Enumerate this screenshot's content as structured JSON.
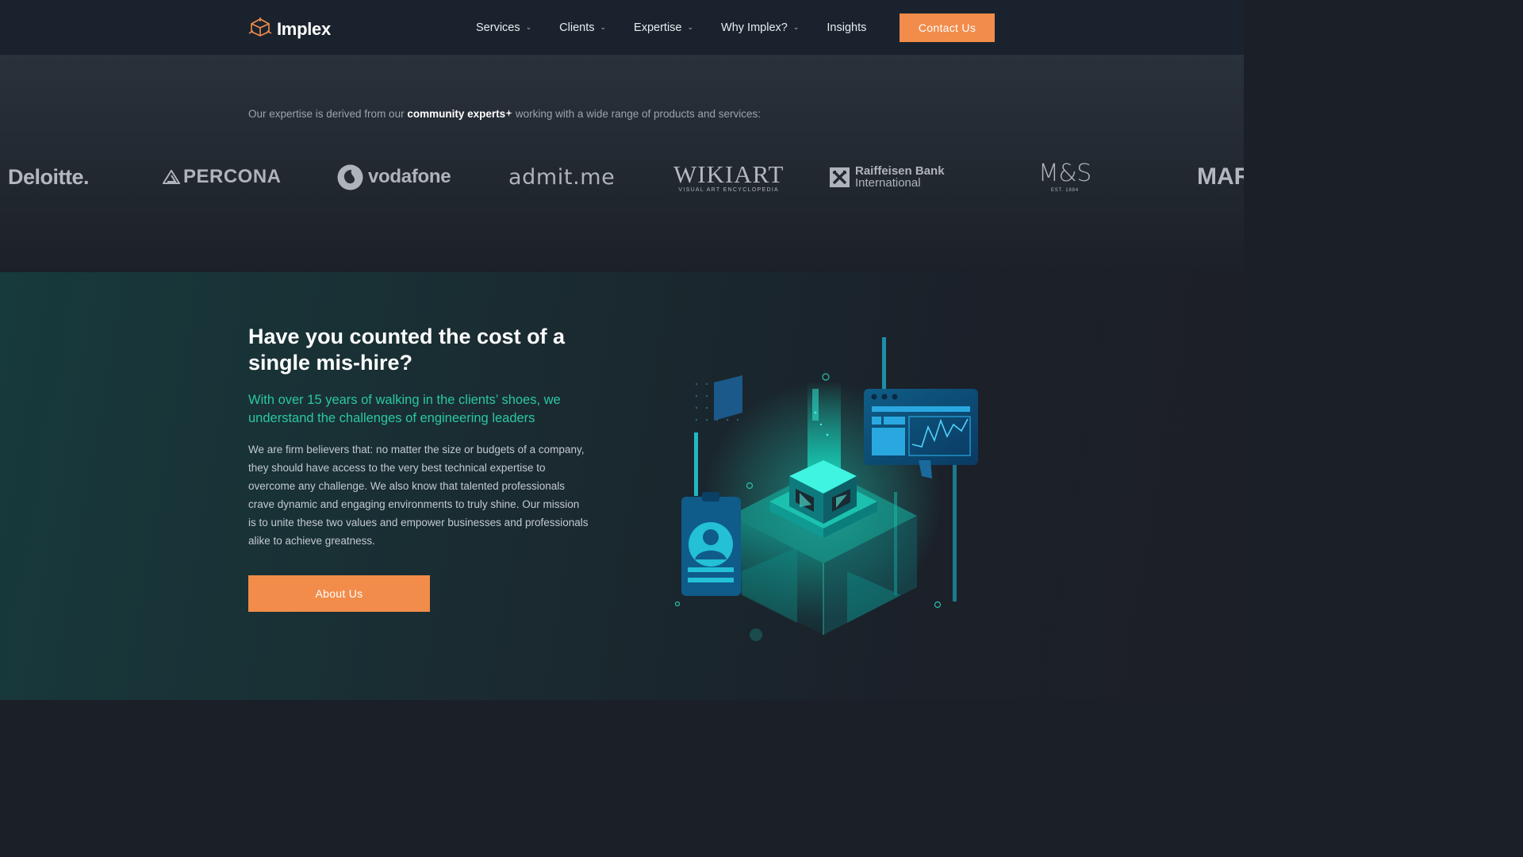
{
  "header": {
    "brand": "Implex",
    "nav": [
      {
        "label": "Services",
        "has_dropdown": true
      },
      {
        "label": "Clients",
        "has_dropdown": true
      },
      {
        "label": "Expertise",
        "has_dropdown": true
      },
      {
        "label": "Why Implex?",
        "has_dropdown": true
      },
      {
        "label": "Insights",
        "has_dropdown": false
      }
    ],
    "contact_label": "Contact Us"
  },
  "clients": {
    "intro_before": "Our expertise is derived from our ",
    "intro_highlight": "community experts",
    "intro_after": " working with a wide range of products and services:",
    "logos": [
      {
        "name": "Deloitte."
      },
      {
        "name": "PERCONA"
      },
      {
        "name": "vodafone"
      },
      {
        "name": "admit.me"
      },
      {
        "name": "WikiArt",
        "tagline": "VISUAL ART ENCYCLOPEDIA"
      },
      {
        "name": "Raiffeisen Bank",
        "tagline": "International"
      },
      {
        "name": "M&S",
        "tagline": "EST. 1884"
      },
      {
        "name": "MAR"
      }
    ]
  },
  "mishire": {
    "title": "Have you counted the cost of a single mis-hire?",
    "subtitle": "With over 15 years of walking in the clients’ shoes, we understand the challenges of engineering leaders",
    "body": "We are firm believers that: no matter the size or budgets of a company, they should have access to the very best technical expertise to overcome any challenge. We also know that talented professionals crave dynamic and engaging environments to truly shine. Our mission is to unite these two values and empower businesses and professionals alike to achieve greatness.",
    "button_label": "About Us"
  },
  "colors": {
    "accent": "#f28c4b",
    "teal": "#2bc7a4",
    "header_bg": "#1a232d"
  },
  "icons": {
    "logo": "implex-cube-icon",
    "dropdown": "chevron-down-icon",
    "illustration": "isometric-cube-illustration"
  }
}
